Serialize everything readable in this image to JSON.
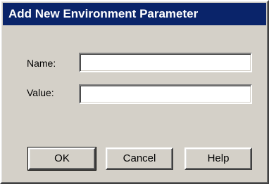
{
  "window": {
    "title": "Add New Environment Parameter"
  },
  "form": {
    "name_label": "Name:",
    "name_value": "",
    "value_label": "Value:",
    "value_value": ""
  },
  "buttons": {
    "ok_label": "OK",
    "cancel_label": "Cancel",
    "help_label": "Help"
  },
  "colors": {
    "titlebar": "#0a246a",
    "dialog_face": "#d4d0c8"
  }
}
